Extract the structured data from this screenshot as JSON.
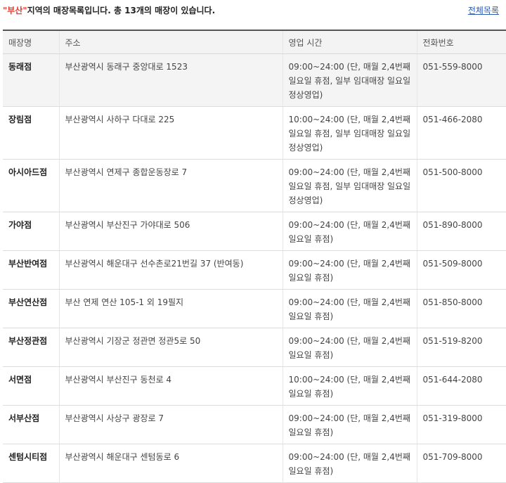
{
  "summary": {
    "region_open_quote": "\"",
    "region": "부산",
    "region_close_quote": "\"",
    "text": "지역의 매장목록입니다. 총 13개의 매장이 있습니다."
  },
  "all_link": "전체목록",
  "table": {
    "headers": [
      "매장명",
      "주소",
      "영업 시간",
      "전화번호"
    ],
    "rows": [
      {
        "name": "동래점",
        "address": "부산광역시 동래구 중앙대로 1523",
        "hours": "09:00~24:00 (단, 매월 2,4번째 일요일 휴점, 일부 임대매장 일요일 정상영업)",
        "phone": "051-559-8000"
      },
      {
        "name": "장림점",
        "address": "부산광역시 사하구 다대로 225",
        "hours": "10:00~24:00 (단, 매월 2,4번째 일요일 휴점, 일부 임대매장 일요일 정상영업)",
        "phone": "051-466-2080"
      },
      {
        "name": "아시아드점",
        "address": "부산광역시 연제구 종합운동장로 7",
        "hours": "09:00~24:00 (단, 매월 2,4번째 일요일 휴점, 일부 임대매장 일요일 정상영업)",
        "phone": "051-500-8000"
      },
      {
        "name": "가야점",
        "address": "부산광역시 부산진구 가야대로 506",
        "hours": "09:00~24:00 (단, 매월 2,4번째 일요일 휴점)",
        "phone": "051-890-8000"
      },
      {
        "name": "부산반여점",
        "address": "부산광역시 해운대구 선수촌로21번길 37 (반여동)",
        "hours": "09:00~24:00 (단, 매월 2,4번째 일요일 휴점)",
        "phone": "051-509-8000"
      },
      {
        "name": "부산연산점",
        "address": "부산 연제 연산 105-1 외 19필지",
        "hours": "09:00~24:00 (단, 매월 2,4번째 일요일 휴점)",
        "phone": "051-850-8000"
      },
      {
        "name": "부산정관점",
        "address": "부산광역시 기장군 정관면 정관5로 50",
        "hours": "09:00~24:00 (단, 매월 2,4번째 일요일 휴점)",
        "phone": "051-519-8200"
      },
      {
        "name": "서면점",
        "address": "부산광역시 부산진구 동천로 4",
        "hours": "10:00~24:00 (단, 매월 2,4번째 일요일 휴점)",
        "phone": "051-644-2080"
      },
      {
        "name": "서부산점",
        "address": "부산광역시 사상구 광장로 7",
        "hours": "09:00~24:00 (단, 매월 2,4번째 일요일 휴점)",
        "phone": "051-319-8000"
      },
      {
        "name": "센텀시티점",
        "address": "부산광역시 해운대구 센텀동로 6",
        "hours": "09:00~24:00 (단, 매월 2,4번째 일요일 휴점)",
        "phone": "051-709-8000"
      }
    ]
  }
}
